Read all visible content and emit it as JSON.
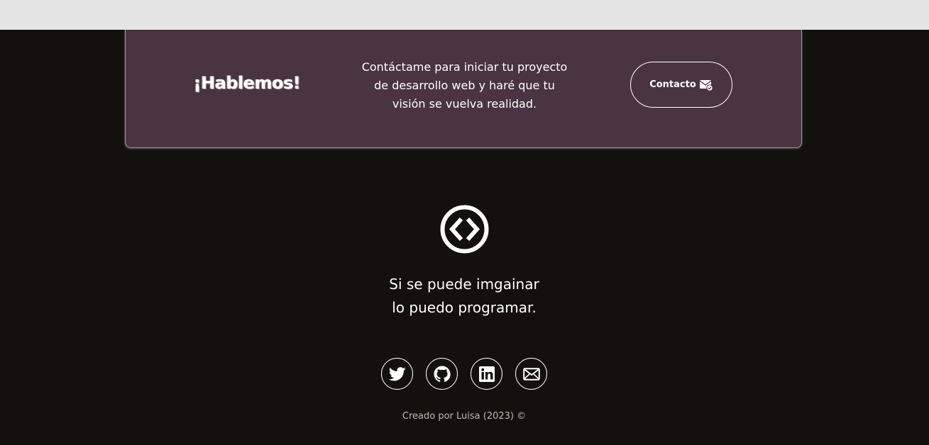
{
  "cta": {
    "title": "¡Hablemos!",
    "text": "Contáctame para iniciar tu proyecto de desarrollo web y haré que tu visión se vuelva realidad.",
    "button_label": "Contacto",
    "button_icon": "mail-check-icon",
    "background": "#4a3441"
  },
  "logo": {
    "icon": "code-brackets-icon"
  },
  "tagline": {
    "line1": "Si se puede imgainar",
    "line2": "lo puedo programar."
  },
  "socials": [
    {
      "name": "twitter",
      "icon": "twitter-icon"
    },
    {
      "name": "github",
      "icon": "github-icon"
    },
    {
      "name": "linkedin",
      "icon": "linkedin-icon"
    },
    {
      "name": "email",
      "icon": "envelope-icon"
    }
  ],
  "footer": {
    "credit": "Creado por Luisa (2023) ©"
  },
  "colors": {
    "page_background": "#12110d",
    "top_band": "#e5e5e5",
    "accent": "#ffffff"
  }
}
